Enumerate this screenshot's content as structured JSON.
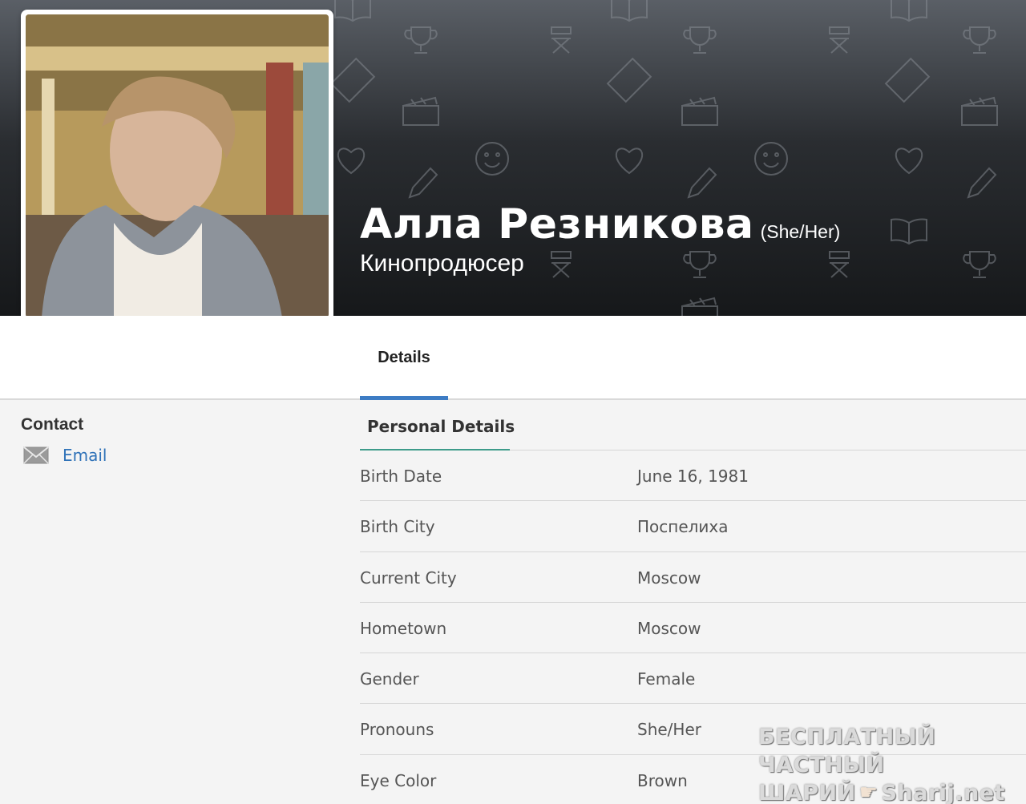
{
  "header": {
    "name": "Алла Резникова",
    "pronouns": "(She/Her)",
    "profession": "Кинопродюсер"
  },
  "tabs": [
    {
      "label": "Details",
      "active": true
    }
  ],
  "contact": {
    "title": "Contact",
    "email_label": "Email",
    "email_icon": "envelope-icon"
  },
  "personal_details": {
    "title": "Personal Details",
    "rows": [
      {
        "label": "Birth Date",
        "value": "June 16, 1981"
      },
      {
        "label": "Birth City",
        "value": "Поспелиха"
      },
      {
        "label": "Current City",
        "value": "Moscow"
      },
      {
        "label": "Hometown",
        "value": "Moscow"
      },
      {
        "label": "Gender",
        "value": "Female"
      },
      {
        "label": "Pronouns",
        "value": "She/Her"
      },
      {
        "label": "Eye Color",
        "value": "Brown"
      }
    ]
  },
  "watermark": {
    "line1": "БЕСПЛАТНЫЙ ЧАСТНЫЙ",
    "line2a": "ШАРИЙ",
    "line2b": "Sharij.net"
  },
  "colors": {
    "accent_blue": "#3d7cc4",
    "section_underline": "#3d9b8a",
    "link": "#2f72b8"
  }
}
